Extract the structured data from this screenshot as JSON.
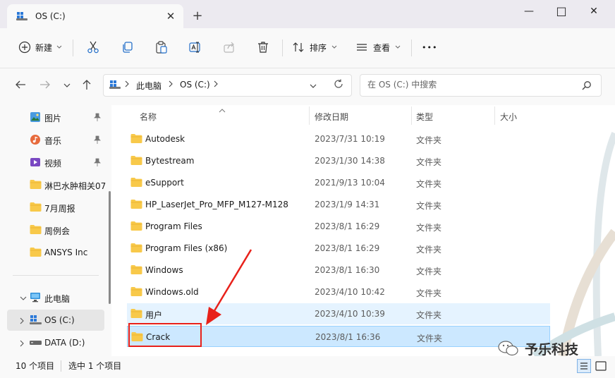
{
  "window": {
    "tab_title": "OS (C:)",
    "new_tab_label": "+",
    "tab_close_label": "✕",
    "minimize_label": "—",
    "maximize_label": "□",
    "close_label": "✕"
  },
  "toolbar": {
    "new_label": "新建",
    "sort_label": "排序",
    "view_label": "查看",
    "more_label": "•••",
    "icons": [
      "cut-icon",
      "copy-icon",
      "paste-icon",
      "rename-icon",
      "share-icon",
      "delete-icon"
    ]
  },
  "address": {
    "segments": [
      "此电脑",
      "OS (C:)"
    ],
    "search_placeholder": "在 OS (C:) 中搜索"
  },
  "nav": {
    "quick_access": [
      {
        "label": "图片",
        "icon": "pictures-icon",
        "pinned": true
      },
      {
        "label": "音乐",
        "icon": "music-icon",
        "pinned": true
      },
      {
        "label": "视频",
        "icon": "videos-icon",
        "pinned": true
      },
      {
        "label": "淋巴水肿相关07",
        "icon": "folder-icon",
        "pinned": false
      },
      {
        "label": "7月周报",
        "icon": "folder-icon",
        "pinned": false
      },
      {
        "label": "周例会",
        "icon": "folder-icon",
        "pinned": false
      },
      {
        "label": "ANSYS Inc",
        "icon": "folder-icon",
        "pinned": false
      }
    ],
    "this_pc": "此电脑",
    "drives": [
      {
        "label": "OS (C:)",
        "selected": true
      },
      {
        "label": "DATA (D:)",
        "selected": false
      }
    ]
  },
  "columns": {
    "name": "名称",
    "modified": "修改日期",
    "type": "类型",
    "size": "大小"
  },
  "files": [
    {
      "name": "Autodesk",
      "modified": "2023/7/31 10:19",
      "type": "文件夹"
    },
    {
      "name": "Bytestream",
      "modified": "2023/1/30 14:38",
      "type": "文件夹"
    },
    {
      "name": "eSupport",
      "modified": "2021/9/13 10:04",
      "type": "文件夹"
    },
    {
      "name": "HP_LaserJet_Pro_MFP_M127-M128",
      "modified": "2023/1/9 14:31",
      "type": "文件夹"
    },
    {
      "name": "Program Files",
      "modified": "2023/8/1 16:29",
      "type": "文件夹"
    },
    {
      "name": "Program Files (x86)",
      "modified": "2023/8/1 16:29",
      "type": "文件夹"
    },
    {
      "name": "Windows",
      "modified": "2023/8/1 16:30",
      "type": "文件夹"
    },
    {
      "name": "Windows.old",
      "modified": "2023/4/10 10:42",
      "type": "文件夹"
    },
    {
      "name": "用户",
      "modified": "2023/4/10 10:39",
      "type": "文件夹"
    },
    {
      "name": "Crack",
      "modified": "2023/8/1 16:36",
      "type": "文件夹"
    }
  ],
  "status": {
    "item_count": "10 个项目",
    "selected": "选中 1 个项目"
  },
  "watermark": {
    "text": "予乐科技"
  },
  "colors": {
    "accent": "#0067c0",
    "selection": "#cce8ff",
    "hover": "#e5f3ff",
    "annotation_red": "#e8211a",
    "folder": "#f8c94a"
  }
}
